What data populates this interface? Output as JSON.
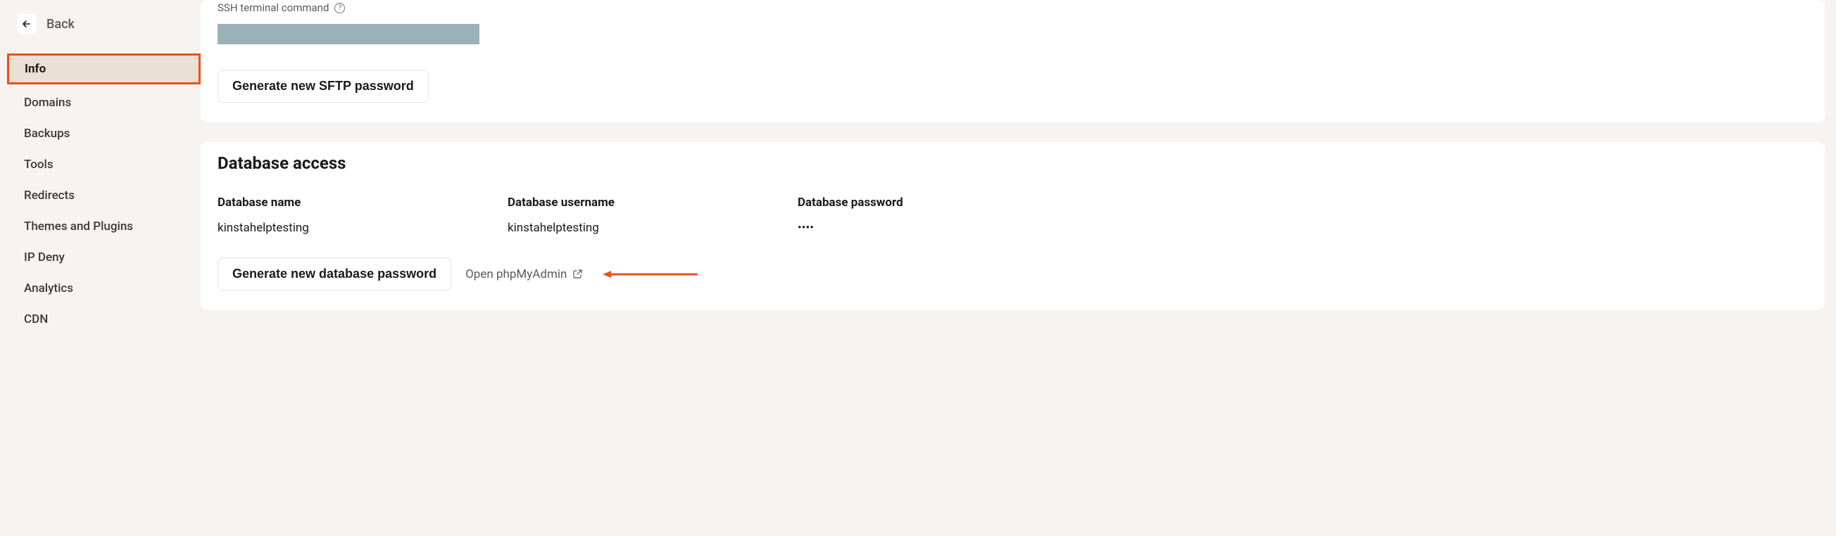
{
  "sidebar": {
    "back_label": "Back",
    "items": [
      {
        "label": "Info",
        "active": true
      },
      {
        "label": "Domains",
        "active": false
      },
      {
        "label": "Backups",
        "active": false
      },
      {
        "label": "Tools",
        "active": false
      },
      {
        "label": "Redirects",
        "active": false
      },
      {
        "label": "Themes and Plugins",
        "active": false
      },
      {
        "label": "IP Deny",
        "active": false
      },
      {
        "label": "Analytics",
        "active": false
      },
      {
        "label": "CDN",
        "active": false
      }
    ]
  },
  "ssh": {
    "label": "SSH terminal command",
    "generate_sftp_button": "Generate new SFTP password"
  },
  "database": {
    "section_title": "Database access",
    "name_label": "Database name",
    "name_value": "kinstahelptesting",
    "username_label": "Database username",
    "username_value": "kinstahelptesting",
    "password_label": "Database password",
    "password_value": "••••",
    "generate_db_button": "Generate new database password",
    "open_phpmyadmin": "Open phpMyAdmin"
  }
}
